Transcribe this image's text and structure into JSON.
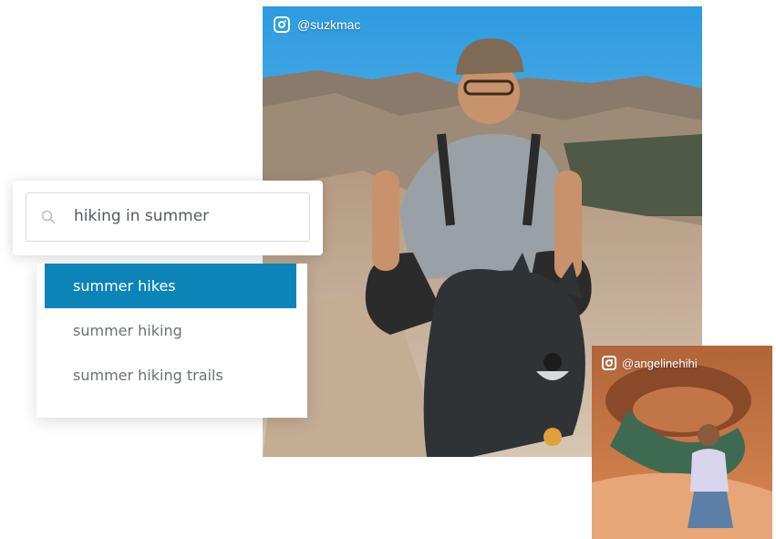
{
  "search": {
    "query": "hiking in summer",
    "icon": "search-icon"
  },
  "suggestions": [
    {
      "label": "summer hikes",
      "selected": true
    },
    {
      "label": "summer hiking",
      "selected": false
    },
    {
      "label": "summer hiking trails",
      "selected": false
    }
  ],
  "photos": [
    {
      "handle": "@suzkmac",
      "icon": "instagram-icon"
    },
    {
      "handle": "@angelinehihi",
      "icon": "instagram-icon"
    }
  ],
  "colors": {
    "accent": "#0d84b8",
    "sky": "#38a9e4",
    "rock": "#c9b29a"
  }
}
